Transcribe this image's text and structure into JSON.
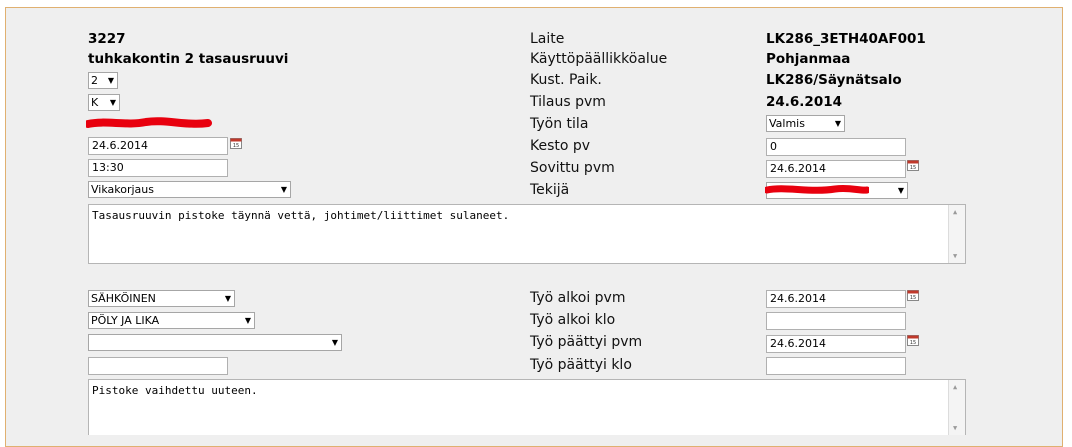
{
  "left_header": {
    "order_number": "3227",
    "order_title": "tuhkakontin 2 tasausruuvi"
  },
  "left_fields": {
    "priority_select": "2",
    "type_select": "K",
    "order_date_value": "24.6.2014",
    "time_value": "13:30",
    "work_type_select": "Vikakorjaus"
  },
  "right_labels": {
    "device": "Laite",
    "area": "Käyttöpäällikköalue",
    "cost_center": "Kust. Paik.",
    "order_date": "Tilaus pvm",
    "work_status": "Työn tila",
    "duration": "Kesto pv",
    "agreed_date": "Sovittu pvm",
    "performer": "Tekijä"
  },
  "right_values": {
    "device": "LK286_3ETH40AF001",
    "area": "Pohjanmaa",
    "cost_center": "LK286/Säynätsalo",
    "order_date": "24.6.2014",
    "work_status_select": "Valmis",
    "duration_value": "0",
    "agreed_date_value": "24.6.2014"
  },
  "description": "Tasausruuvin pistoke täynnä vettä, johtimet/liittimet sulaneet.",
  "lower_left": {
    "category_select": "SÄHKÖINEN",
    "cause_select": "PÖLY JA LIKA",
    "extra_select": "",
    "extra_input": ""
  },
  "lower_labels": {
    "work_start_date": "Työ alkoi pvm",
    "work_start_time": "Työ alkoi klo",
    "work_end_date": "Työ päättyi pvm",
    "work_end_time": "Työ päättyi klo"
  },
  "lower_values": {
    "work_start_date": "24.6.2014",
    "work_start_time": "",
    "work_end_date": "24.6.2014",
    "work_end_time": ""
  },
  "resolution": "Pistoke vaihdettu uuteen.",
  "icons": {
    "calendar": "calendar-icon",
    "dropdown": "chevron-down-icon"
  },
  "colors": {
    "panel_border": "#e0b070",
    "redaction": "#e8000e"
  }
}
